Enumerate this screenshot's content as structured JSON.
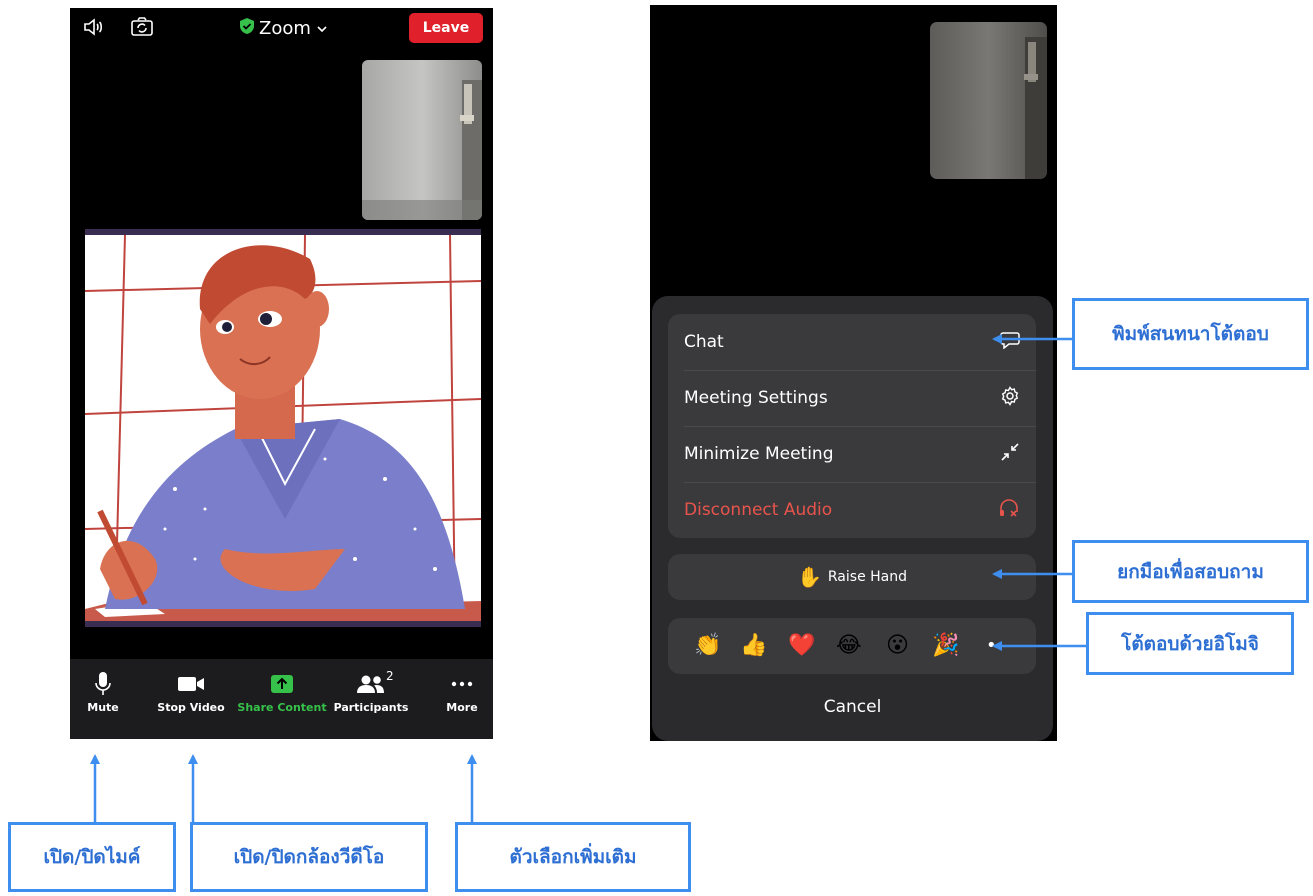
{
  "left_phone": {
    "header": {
      "title": "Zoom",
      "leave_label": "Leave",
      "icons": [
        "speaker-icon",
        "switch-camera-icon",
        "shield-check-icon",
        "chevron-down-icon"
      ]
    },
    "toolbar": {
      "mute_label": "Mute",
      "stop_video_label": "Stop Video",
      "share_label": "Share Content",
      "participants_label": "Participants",
      "participants_count": "2",
      "more_label": "More"
    }
  },
  "right_phone": {
    "menu": {
      "chat_label": "Chat",
      "settings_label": "Meeting Settings",
      "minimize_label": "Minimize Meeting",
      "disconnect_label": "Disconnect Audio",
      "raise_hand_label": "Raise Hand",
      "raise_hand_emoji": "✋",
      "reactions": [
        "👏",
        "👍",
        "❤️",
        "😂",
        "😮",
        "🎉"
      ],
      "more_reactions": "•",
      "cancel_label": "Cancel"
    }
  },
  "callouts": {
    "mic": "เปิด/ปิดไมค์",
    "camera": "เปิด/ปิดกล้องวีดีโอ",
    "more": "ตัวเลือกเพิ่มเติม",
    "chat": "พิมพ์สนทนาโต้ตอบ",
    "raise_hand": "ยกมือเพื่อสอบถาม",
    "emoji": "โต้ตอบด้วยอิโมจิ"
  },
  "colors": {
    "leave_red": "#e0202b",
    "share_green": "#36c24a",
    "disconnect_red": "#e8544b",
    "callout_blue": "#3d8eef",
    "sheet_bg": "#2b2b2e",
    "group_bg": "#3a3a3d"
  }
}
